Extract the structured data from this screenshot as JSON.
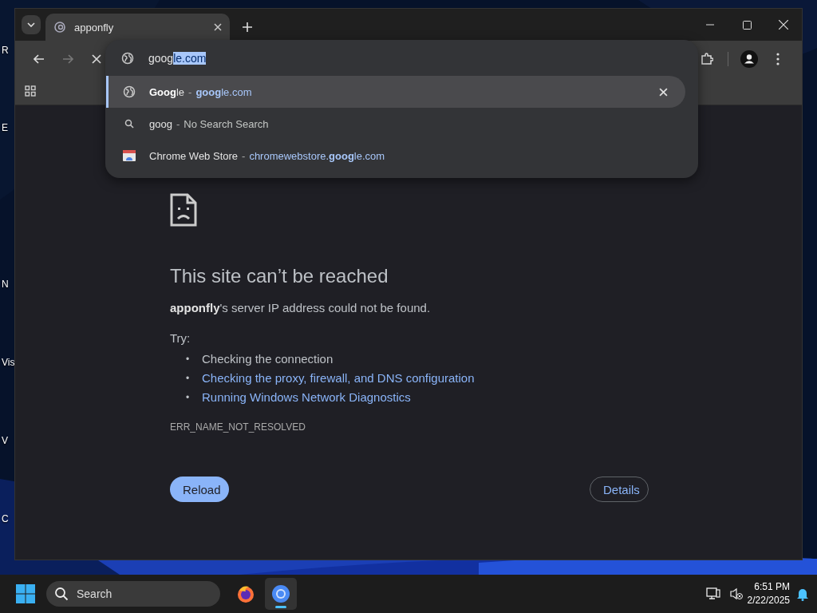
{
  "desktop": {
    "icon_labels": [
      "R",
      "E",
      "N",
      "Vis",
      "V",
      "C"
    ]
  },
  "browser": {
    "tabs": [
      {
        "title": "apponfly",
        "selected": true
      }
    ],
    "omnibox": {
      "typed": "goog",
      "autocomplete": "le.com"
    },
    "suggestions": [
      {
        "kind": "globe",
        "title": "**Goog**le",
        "separator": "-",
        "detail": "**goog**le.com",
        "selected": true
      },
      {
        "kind": "search",
        "title": "goog",
        "separator": "-",
        "detail": "No Search Search",
        "selected": false
      },
      {
        "kind": "store",
        "title": "Chrome Web Store",
        "separator": "-",
        "detail": "chromewebstore.**goog**le.com",
        "selected": false
      }
    ],
    "error_page": {
      "heading": "This site can’t be reached",
      "message": "**apponfly**'s server IP address could not be found.",
      "try_label": "Try:",
      "suggestions": [
        {
          "kind": "plain",
          "bullet": "•",
          "text": "Checking the connection"
        },
        {
          "kind": "link",
          "bullet": "•",
          "text": "Checking the proxy, firewall, and DNS configuration"
        },
        {
          "kind": "link",
          "bullet": "•",
          "text": "Running Windows Network Diagnostics"
        }
      ],
      "error_code": "ERR_NAME_NOT_RESOLVED",
      "buttons": [
        {
          "label": "Reload",
          "kind": "primary"
        },
        {
          "label": "Details",
          "kind": "outline"
        }
      ]
    }
  },
  "taskbar": {
    "search_placeholder": "Search",
    "apps": [
      {
        "kind": "firefox",
        "selected": false
      },
      {
        "kind": "chrome",
        "selected": true
      }
    ],
    "time": "6:51 PM",
    "date": "2/22/2025"
  }
}
